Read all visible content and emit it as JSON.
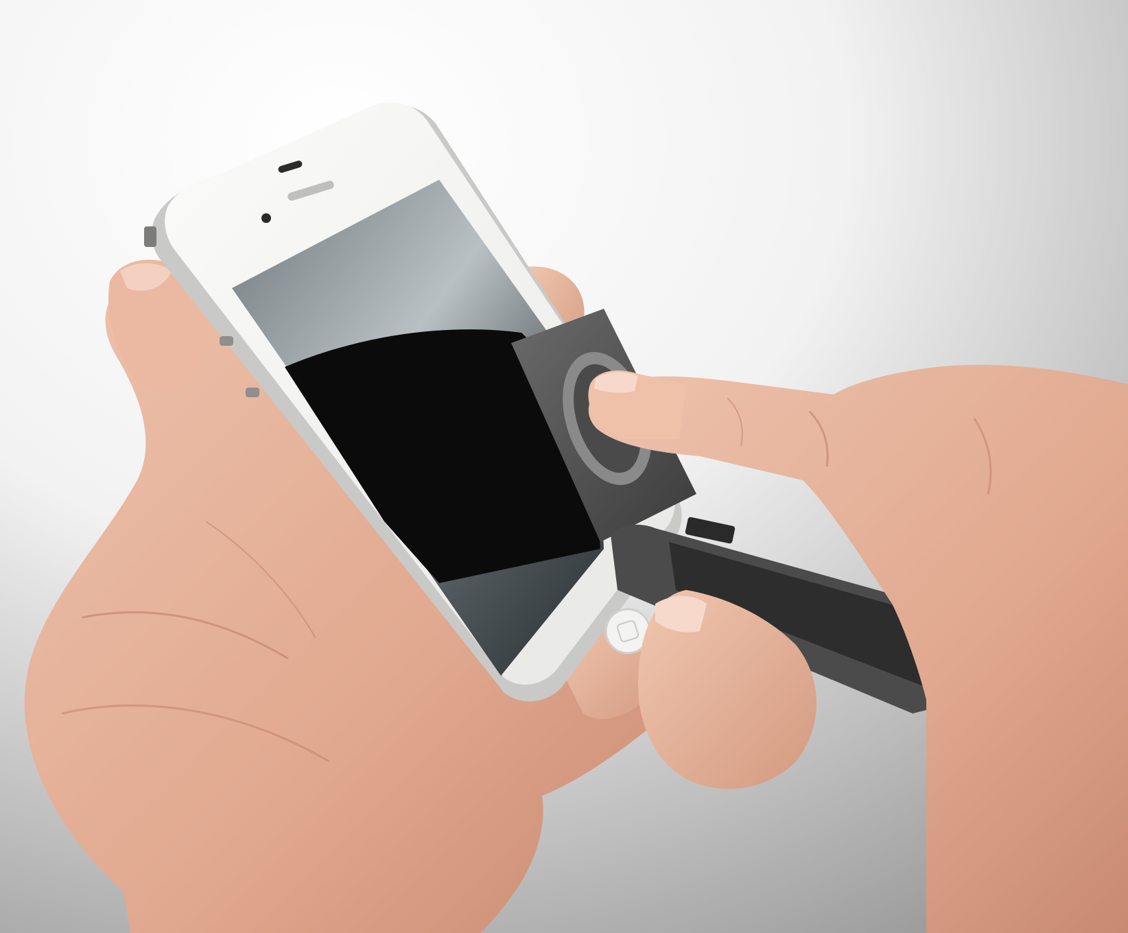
{
  "scene": {
    "subject": "",
    "colors": {
      "background_top": "#ffffff",
      "background_bottom": "#9a9a9a",
      "skin": "#e6b59e",
      "skin_shadow": "#c98d74",
      "phone_body": "#f4f4f2",
      "phone_rim": "#c8c8c6",
      "screen_dark": "#0b0b0b",
      "screen_reflection": "#8a9296",
      "tool_gray": "#555555",
      "tool_pad": "#7f7f7f"
    }
  }
}
